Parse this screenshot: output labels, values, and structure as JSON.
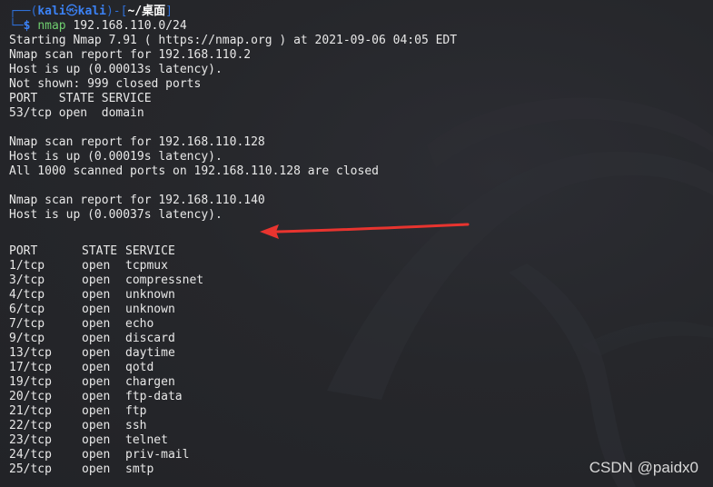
{
  "prompt": {
    "user": "kali",
    "at_symbol": "㉿",
    "host": "kali",
    "dir": "~/桌面",
    "dollar": "$",
    "command": "nmap",
    "args": "192.168.110.0/24"
  },
  "output_lines": [
    "Starting Nmap 7.91 ( https://nmap.org ) at 2021-09-06 04:05 EDT",
    "Nmap scan report for 192.168.110.2",
    "Host is up (0.00013s latency).",
    "Not shown: 999 closed ports",
    "PORT   STATE SERVICE",
    "53/tcp open  domain",
    "",
    "Nmap scan report for 192.168.110.128",
    "Host is up (0.00019s latency).",
    "All 1000 scanned ports on 192.168.110.128 are closed",
    "",
    "Nmap scan report for 192.168.110.140",
    "Host is up (0.00037s latency).",
    ""
  ],
  "ports_header": {
    "port": "PORT",
    "state": "STATE",
    "service": "SERVICE"
  },
  "ports": [
    {
      "port": "1/tcp",
      "state": "open",
      "service": "tcpmux"
    },
    {
      "port": "3/tcp",
      "state": "open",
      "service": "compressnet"
    },
    {
      "port": "4/tcp",
      "state": "open",
      "service": "unknown"
    },
    {
      "port": "6/tcp",
      "state": "open",
      "service": "unknown"
    },
    {
      "port": "7/tcp",
      "state": "open",
      "service": "echo"
    },
    {
      "port": "9/tcp",
      "state": "open",
      "service": "discard"
    },
    {
      "port": "13/tcp",
      "state": "open",
      "service": "daytime"
    },
    {
      "port": "17/tcp",
      "state": "open",
      "service": "qotd"
    },
    {
      "port": "19/tcp",
      "state": "open",
      "service": "chargen"
    },
    {
      "port": "20/tcp",
      "state": "open",
      "service": "ftp-data"
    },
    {
      "port": "21/tcp",
      "state": "open",
      "service": "ftp"
    },
    {
      "port": "22/tcp",
      "state": "open",
      "service": "ssh"
    },
    {
      "port": "23/tcp",
      "state": "open",
      "service": "telnet"
    },
    {
      "port": "24/tcp",
      "state": "open",
      "service": "priv-mail"
    },
    {
      "port": "25/tcp",
      "state": "open",
      "service": "smtp"
    }
  ],
  "watermark": "CSDN @paidx0",
  "colors": {
    "background": "#242529",
    "prompt_blue": "#3b82f6",
    "command_green": "#6fcf6f",
    "annotation_arrow": "#e8342f"
  }
}
